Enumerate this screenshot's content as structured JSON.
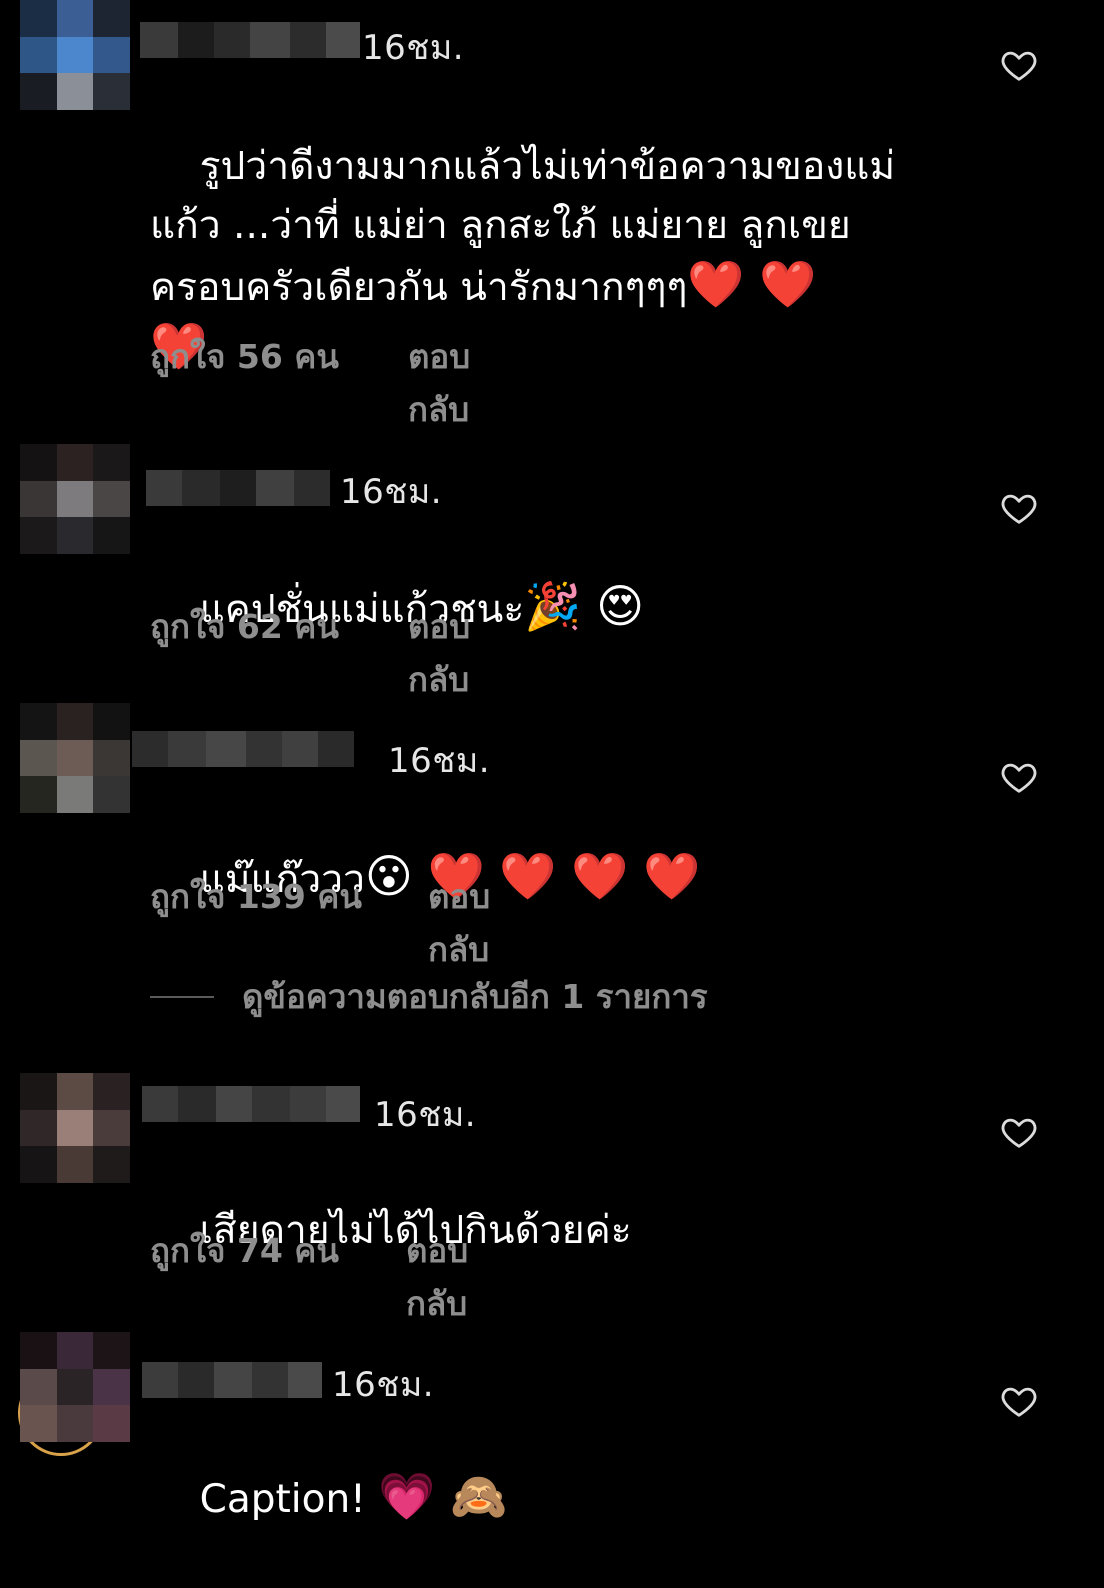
{
  "comments": [
    {
      "time": "16ชม.",
      "text": "รูปว่าดีงามมากแล้วไม่เท่าข้อความของแม่\nแก้ว ...ว่าที่ แม่ย่า ลูกสะใภ้ แม่ยาย ลูกเขย\nครอบครัวเดียวกัน น่ารักมากๆๆๆ",
      "emojis": "❤️ ❤️\n❤️",
      "likes": "ถูกใจ 56 คน",
      "reply": "ตอบกลับ"
    },
    {
      "time": "16ชม.",
      "text": "แคปชั่นแม่แก้วชนะ",
      "emojis": "🎉 😍",
      "likes": "ถูกใจ 62 คน",
      "reply": "ตอบกลับ"
    },
    {
      "time": "16ชม.",
      "text": "แม๊แก๊ววว",
      "emojis": "😮 ❤️ ❤️ ❤️ ❤️",
      "likes": "ถูกใจ 139 คน",
      "reply": "ตอบกลับ"
    },
    {
      "time": "16ชม.",
      "text": "เสียดายไม่ได้ไปกินด้วยค่ะ",
      "emojis": "",
      "likes": "ถูกใจ 74 คน",
      "reply": "ตอบกลับ"
    },
    {
      "time": "16ชม.",
      "text": "Caption!",
      "emojis": "💗 🙈",
      "likes": "",
      "reply": ""
    }
  ],
  "view_more_replies": "ดูข้อความตอบกลับอีก 1 รายการ",
  "icons": {
    "like": "heart-outline-icon"
  },
  "colors": {
    "background": "#000000",
    "text": "#ffffff",
    "muted": "#8e8e8e"
  }
}
